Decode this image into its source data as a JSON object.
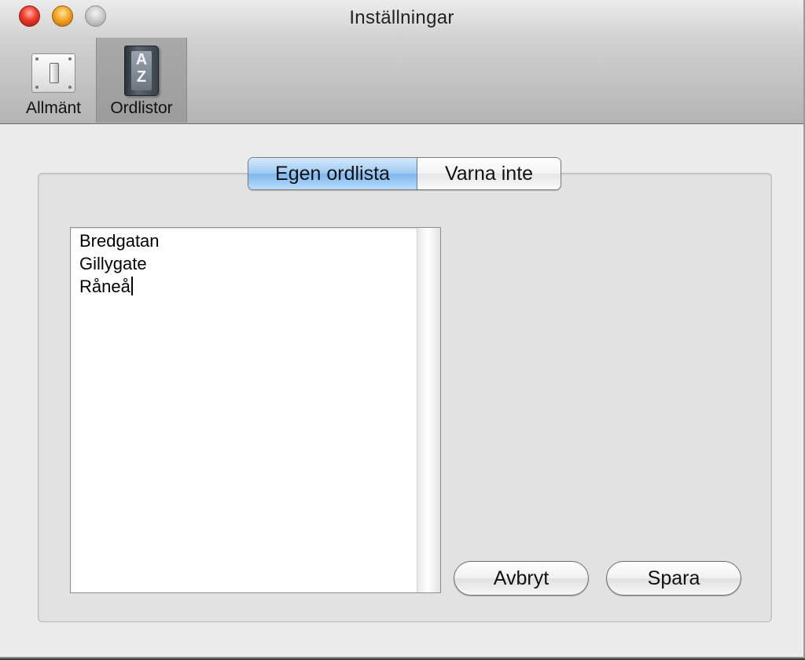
{
  "window": {
    "title": "Inställningar"
  },
  "toolbar": {
    "items": [
      {
        "label": "Allmänt",
        "icon": "toggle-switch-icon",
        "selected": false
      },
      {
        "label": "Ordlistor",
        "icon": "dictionary-book-icon",
        "icon_text_top": "A",
        "icon_text_bottom": "Z",
        "selected": true
      }
    ]
  },
  "tabs": [
    {
      "label": "Egen ordlista",
      "selected": true
    },
    {
      "label": "Varna inte",
      "selected": false
    }
  ],
  "word_list": {
    "items": [
      "Bredgatan",
      "Gillygate",
      "Råneå"
    ]
  },
  "buttons": {
    "cancel_label": "Avbryt",
    "save_label": "Spara"
  },
  "colors": {
    "close": "#ee3b2a",
    "minimize": "#f4a425",
    "zoom": "#c9c9c9",
    "tab_active": "#9fcaf3"
  }
}
